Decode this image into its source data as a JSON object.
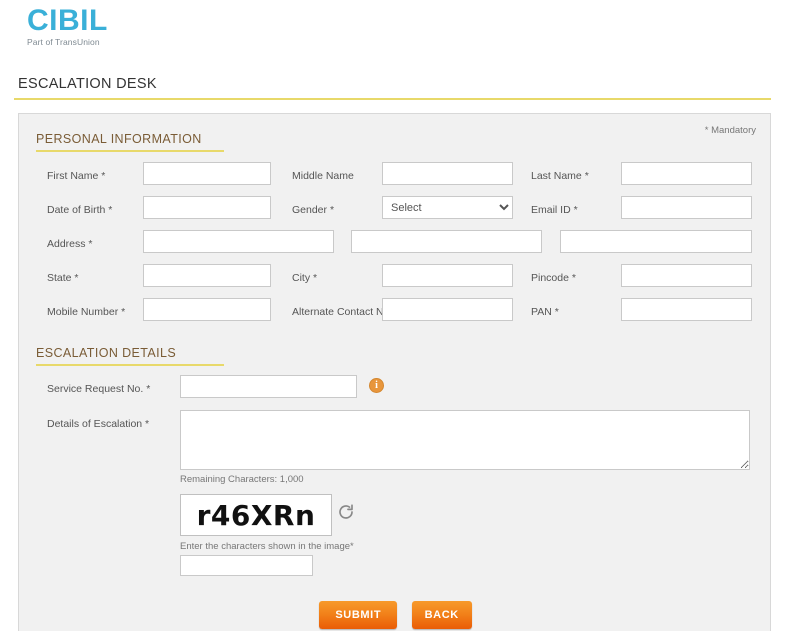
{
  "brand": {
    "logo_main": "CIBIL",
    "logo_sub": "Part of TransUnion",
    "logo_color": "#3ab0d8"
  },
  "page": {
    "title": "ESCALATION DESK",
    "accent_rule_color": "#e8d96a",
    "panel_bg": "#f1f1f1"
  },
  "form": {
    "mandatory_note": "* Mandatory",
    "sections": {
      "personal": {
        "heading": "PERSONAL INFORMATION",
        "fields": {
          "first_name": {
            "label": "First Name *",
            "value": "",
            "placeholder": ""
          },
          "middle_name": {
            "label": "Middle Name",
            "value": "",
            "placeholder": ""
          },
          "last_name": {
            "label": "Last Name *",
            "value": "",
            "placeholder": ""
          },
          "dob": {
            "label": "Date of Birth *",
            "value": "",
            "placeholder": ""
          },
          "gender": {
            "label": "Gender *",
            "value": "Select",
            "options": [
              "Select"
            ]
          },
          "email": {
            "label": "Email ID *",
            "value": "",
            "placeholder": ""
          },
          "address": {
            "label": "Address *",
            "value": "",
            "value2": "",
            "value3": "",
            "placeholder": ""
          },
          "state": {
            "label": "State *",
            "value": "",
            "placeholder": ""
          },
          "city": {
            "label": "City *",
            "value": "",
            "placeholder": ""
          },
          "pincode": {
            "label": "Pincode *",
            "value": "",
            "placeholder": ""
          },
          "mobile": {
            "label": "Mobile Number *",
            "value": "",
            "placeholder": ""
          },
          "alt_contact": {
            "label": "Alternate Contact No.",
            "value": "",
            "placeholder": ""
          },
          "pan": {
            "label": "PAN *",
            "value": "",
            "placeholder": ""
          }
        }
      },
      "escalation": {
        "heading": "ESCALATION DETAILS",
        "fields": {
          "service_request_no": {
            "label": "Service Request No. *",
            "value": "",
            "placeholder": "",
            "info_icon": "info-icon"
          },
          "details": {
            "label": "Details of Escalation *",
            "value": "",
            "placeholder": ""
          }
        },
        "remaining_characters": "Remaining Characters: 1,000"
      }
    },
    "captcha": {
      "text": "r46XRn",
      "refresh_icon": "refresh-icon",
      "help": "Enter the characters shown in the image*",
      "input_value": "",
      "input_placeholder": ""
    },
    "buttons": {
      "submit": "SUBMIT",
      "back": "BACK",
      "color": "#ee7014"
    }
  }
}
